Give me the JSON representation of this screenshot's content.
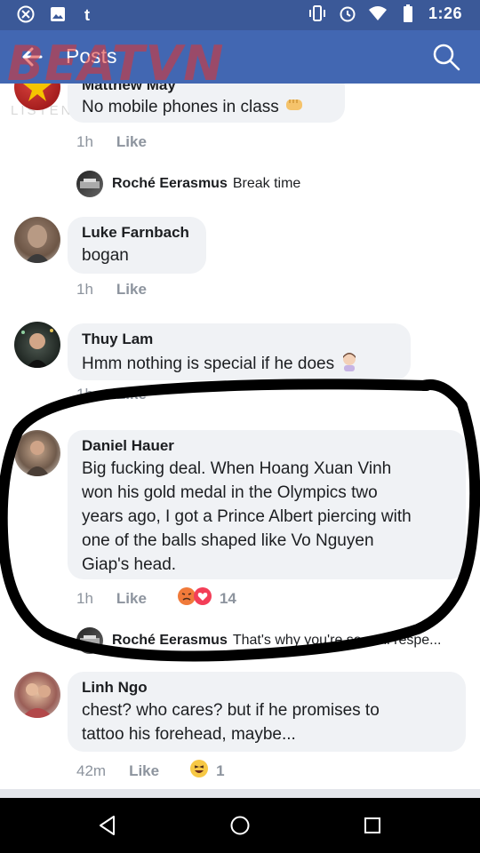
{
  "status_bar": {
    "time": "1:26",
    "left_icons": [
      "xbox-icon",
      "image-icon",
      "tumblr-icon"
    ],
    "right_icons": [
      "vibrate-icon",
      "alarm-icon",
      "wifi-icon",
      "battery-icon"
    ]
  },
  "header": {
    "title": "Posts",
    "back_icon": "back-arrow-icon",
    "search_icon": "search-icon",
    "bg_color": "#4267b2"
  },
  "watermark": {
    "logo": "BEATVN",
    "tagline": "LISTEN TO THE BEAT OF LIFE"
  },
  "comments": [
    {
      "author": "Matthew  May",
      "text": "No mobile phones in class",
      "time": "1h",
      "like": "Like",
      "emoji": "fist-emoji"
    },
    {
      "reply": true,
      "author": "Roché Eerasmus",
      "text": "Break time"
    },
    {
      "author": "Luke Farnbach",
      "text": "bogan",
      "time": "1h",
      "like": "Like"
    },
    {
      "author": "Thuy Lam",
      "text": "Hmm nothing is special if he does",
      "time": "1h",
      "like": "Like",
      "emoji": "thinking-woman-emoji"
    },
    {
      "author": "Daniel Hauer",
      "text_lines": [
        "Big fucking deal. When Hoang Xuan Vinh",
        "won his gold medal in the Olympics two",
        "years ago, I got a Prince Albert piercing with",
        "one of the balls shaped like Vo Nguyen",
        "Giap's head."
      ],
      "time": "1h",
      "like": "Like",
      "reaction_count": "14",
      "reactions": [
        "angry-icon",
        "love-icon"
      ]
    },
    {
      "reply": true,
      "author": "Roché Eerasmus",
      "text": "That's why you're so well respe..."
    },
    {
      "author": "Linh Ngo",
      "text_lines": [
        "chest? who cares? but if he promises to",
        "tattoo his forehead, maybe..."
      ],
      "time": "42m",
      "like": "Like",
      "reaction_count": "1",
      "reactions": [
        "haha-icon"
      ]
    }
  ],
  "nav_bar": {
    "buttons": [
      "back-triangle-icon",
      "home-circle-icon",
      "recents-square-icon"
    ]
  }
}
